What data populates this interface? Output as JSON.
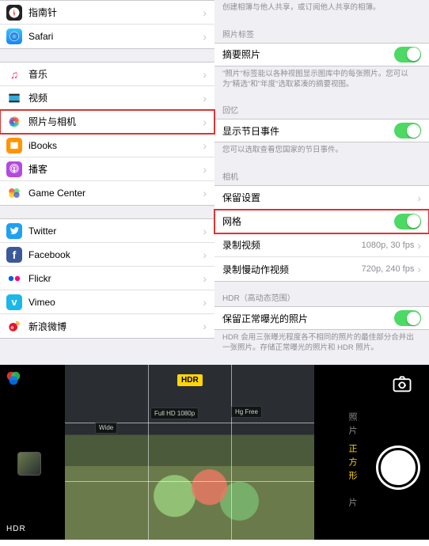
{
  "left": {
    "group1": [
      {
        "key": "compass",
        "label": "指南针",
        "iconClass": "ic-compass"
      },
      {
        "key": "safari",
        "label": "Safari",
        "iconClass": "ic-safari"
      }
    ],
    "group2": [
      {
        "key": "music",
        "label": "音乐",
        "iconClass": "ic-music"
      },
      {
        "key": "video",
        "label": "视频",
        "iconClass": "ic-video"
      },
      {
        "key": "photos",
        "label": "照片与相机",
        "iconClass": "ic-photos",
        "highlighted": true
      },
      {
        "key": "ibooks",
        "label": "iBooks",
        "iconClass": "ic-ibooks"
      },
      {
        "key": "podcast",
        "label": "播客",
        "iconClass": "ic-podcast"
      },
      {
        "key": "gamecenter",
        "label": "Game Center",
        "iconClass": "ic-gc"
      }
    ],
    "group3": [
      {
        "key": "twitter",
        "label": "Twitter",
        "iconClass": "ic-twitter"
      },
      {
        "key": "facebook",
        "label": "Facebook",
        "iconClass": "ic-facebook"
      },
      {
        "key": "flickr",
        "label": "Flickr",
        "iconClass": "ic-flickr"
      },
      {
        "key": "vimeo",
        "label": "Vimeo",
        "iconClass": "ic-vimeo"
      },
      {
        "key": "weibo",
        "label": "新浪微博",
        "iconClass": "ic-weibo"
      }
    ]
  },
  "right": {
    "intro_note": "创建相簿与他人共享，或订阅他人共享的相簿。",
    "sec_photo_tags": "照片标签",
    "summary_photos": {
      "label": "摘要照片",
      "on": true
    },
    "summary_note": "\"照片\"标签能以各种视图显示图库中的每张照片。您可以为\"精选\"和\"年度\"选取紧凑的摘要视图。",
    "sec_memories": "回忆",
    "show_holidays": {
      "label": "显示节日事件",
      "on": true
    },
    "holidays_note": "您可以选取查看您国家的节日事件。",
    "sec_camera": "相机",
    "keep_settings": {
      "label": "保留设置"
    },
    "grid": {
      "label": "网格",
      "on": true,
      "highlighted": true
    },
    "record_video": {
      "label": "录制视频",
      "detail": "1080p, 30 fps"
    },
    "record_slomo": {
      "label": "录制慢动作视频",
      "detail": "720p, 240 fps"
    },
    "sec_hdr": "HDR（高动态范围）",
    "keep_normal": {
      "label": "保留正常曝光的照片",
      "on": true
    },
    "hdr_note": "HDR 会用三张曝光程度各不相同的照片的最佳部分合并出一张照片。存储正常曝光的照片和 HDR 照片。"
  },
  "camera": {
    "hdr_badge": "HDR",
    "hdr_label": "HDR",
    "mode_active": "正方形",
    "mode_above": "照片",
    "mode_below": "片",
    "monitor_text_1": "Full HD 1080p",
    "monitor_text_2": "Hg Free",
    "monitor_text_3": "Wide"
  }
}
